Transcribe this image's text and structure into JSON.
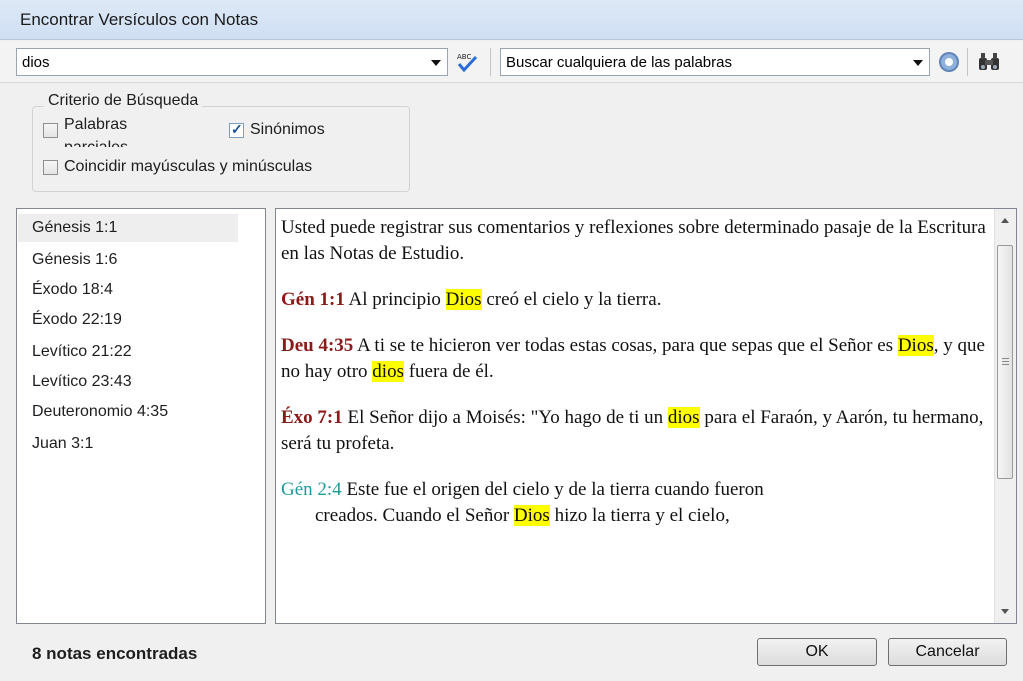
{
  "window": {
    "title": "Encontrar Versículos con Notas"
  },
  "toolbar": {
    "search_value": "dios",
    "mode_value": "Buscar cualquiera de las palabras"
  },
  "criteria": {
    "legend": "Criterio de Búsqueda",
    "partial_words": {
      "label": "Palabras parciales",
      "checked": false
    },
    "synonyms": {
      "label": "Sinónimos",
      "checked": true
    },
    "match_case": {
      "label": "Coincidir mayúsculas y minúsculas",
      "checked": false
    }
  },
  "results": [
    "Génesis 1:1",
    "Génesis 1:6",
    "Éxodo 18:4",
    "Éxodo 22:19",
    "Levítico 21:22",
    "Levítico 23:43",
    "Deuteronomio 4:35",
    "Juan 3:1"
  ],
  "note": {
    "intro": "Usted puede registrar sus comentarios y reflexiones sobre determinado pasaje de la Escritura en las Notas de Estudio.",
    "v1_ref": "Gén 1:1",
    "v1_a": " Al principio ",
    "v1_hl": "Dios",
    "v1_b": " creó el cielo y la tierra.",
    "v2_ref": "Deu 4:35",
    "v2_a": "  A ti se te hicieron ver todas estas cosas, para que sepas que el Señor es ",
    "v2_hl1": "Dios",
    "v2_b": ", y que no hay otro ",
    "v2_hl2": "dios",
    "v2_c": " fuera de él.",
    "v3_ref": "Éxo 7:1",
    "v3_a": "  El Señor dijo a Moisés: \"Yo hago de ti un ",
    "v3_hl": "dios",
    "v3_b": " para el Faraón, y Aarón, tu hermano, será tu profeta.",
    "v4_ref": "Gén 2:4",
    "v4_a": "  Este fue el origen del cielo y de la tierra cuando fueron",
    "v4_b": "creados. Cuando el Señor ",
    "v4_hl": "Dios",
    "v4_c": " hizo la tierra y el cielo,"
  },
  "status": {
    "found": "8 notas encontradas"
  },
  "buttons": {
    "ok": "OK",
    "cancel": "Cancelar"
  },
  "icons": {
    "spellcheck": "spellcheck-icon",
    "gear": "gear-icon",
    "binoculars": "binoculars-icon"
  },
  "colors": {
    "ref_red": "#8b1a1a",
    "ref_teal": "#1f9a9a",
    "highlight": "#ffff00"
  }
}
